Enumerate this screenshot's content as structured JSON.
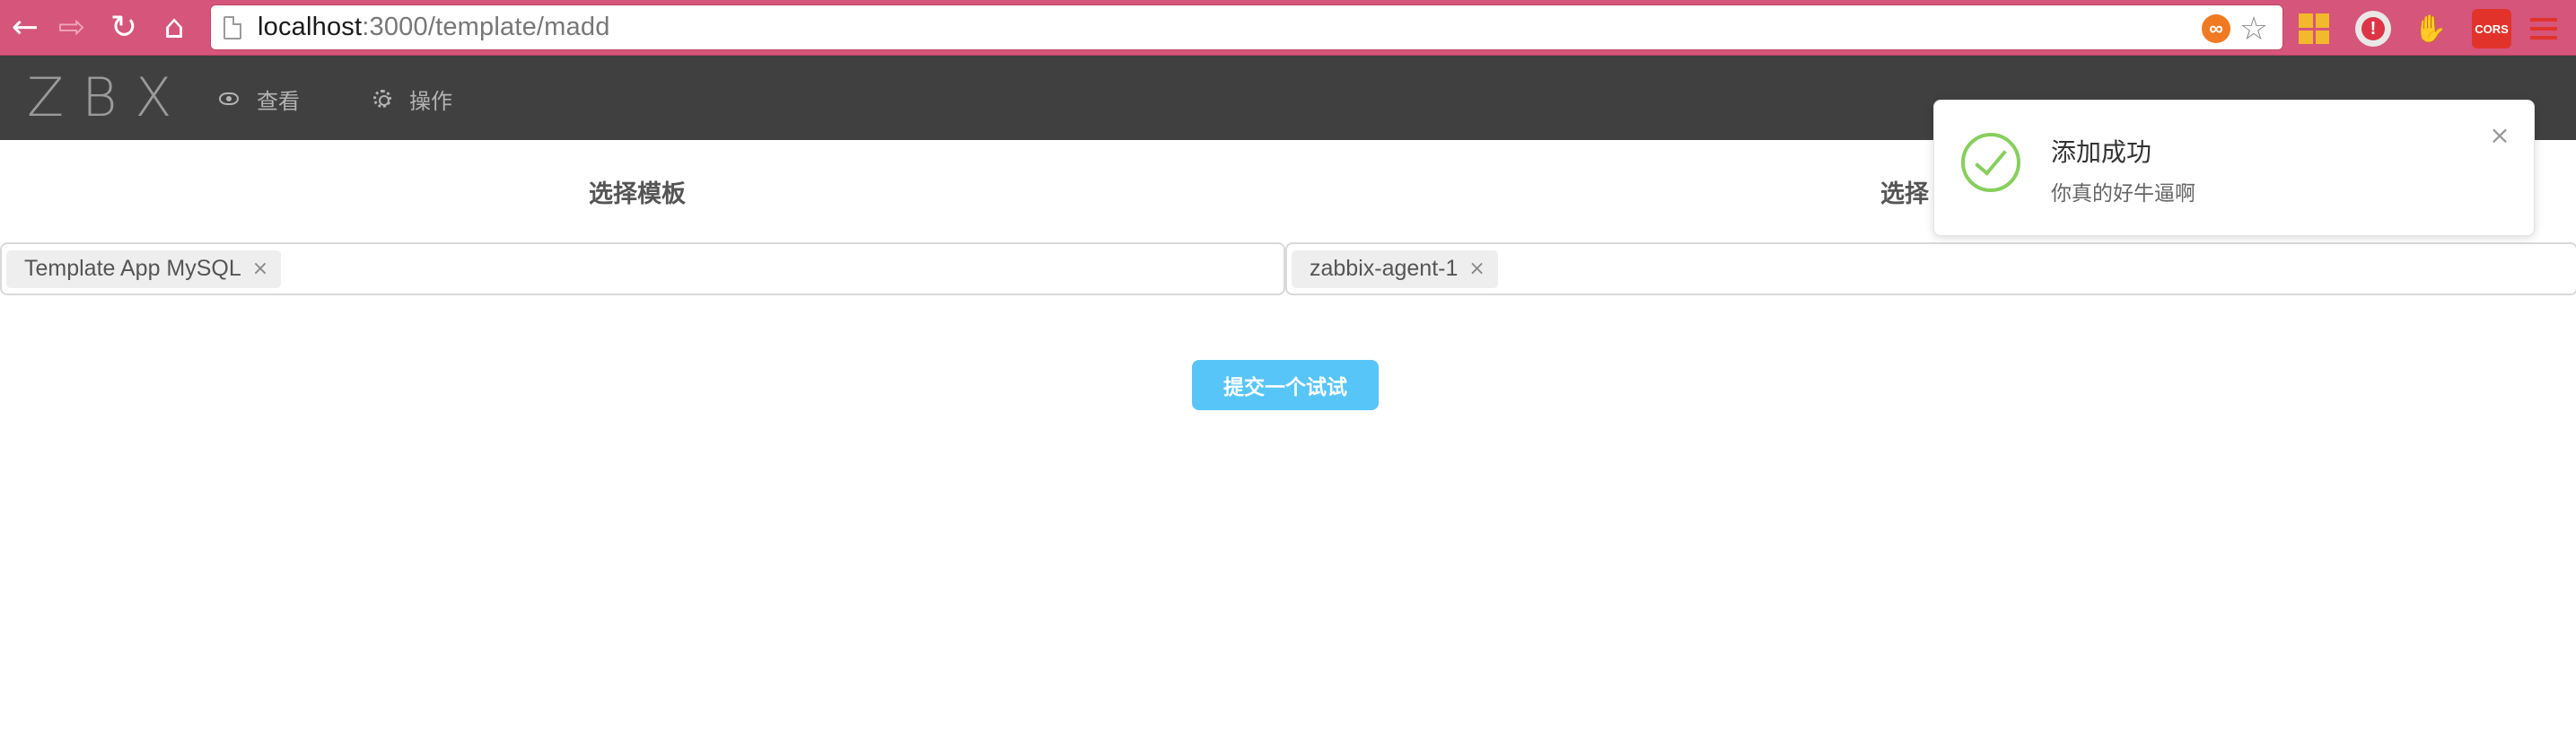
{
  "browser": {
    "url_host": "localhost",
    "url_path": ":3000/template/madd",
    "icons": {
      "back": "←",
      "forward": "⇨",
      "reload": "↻",
      "home": "⌂",
      "bookmark_star": "☆",
      "infinity_ext": "∞",
      "alert_ext": "!",
      "glove_ext": "✋",
      "cors_ext": "CORS"
    }
  },
  "header": {
    "logo": "ZBX",
    "menu": [
      {
        "label": "查看",
        "icon": "eye-icon"
      },
      {
        "label": "操作",
        "icon": "gear-icon"
      }
    ]
  },
  "main": {
    "left_title": "选择模板",
    "right_title": "选择",
    "left_select": {
      "tags": [
        {
          "label": "Template App MySQL",
          "close": "×"
        }
      ]
    },
    "right_select": {
      "tags": [
        {
          "label": "zabbix-agent-1",
          "close": "×"
        }
      ]
    },
    "submit_label": "提交一个试试"
  },
  "notification": {
    "title": "添加成功",
    "description": "你真的好牛逼啊",
    "close": "×",
    "status_color": "#86cf5c"
  },
  "colors": {
    "browser_bar": "#d6557a",
    "header_bg": "#404040",
    "primary_button": "#57c5f7",
    "success": "#86cf5c"
  }
}
